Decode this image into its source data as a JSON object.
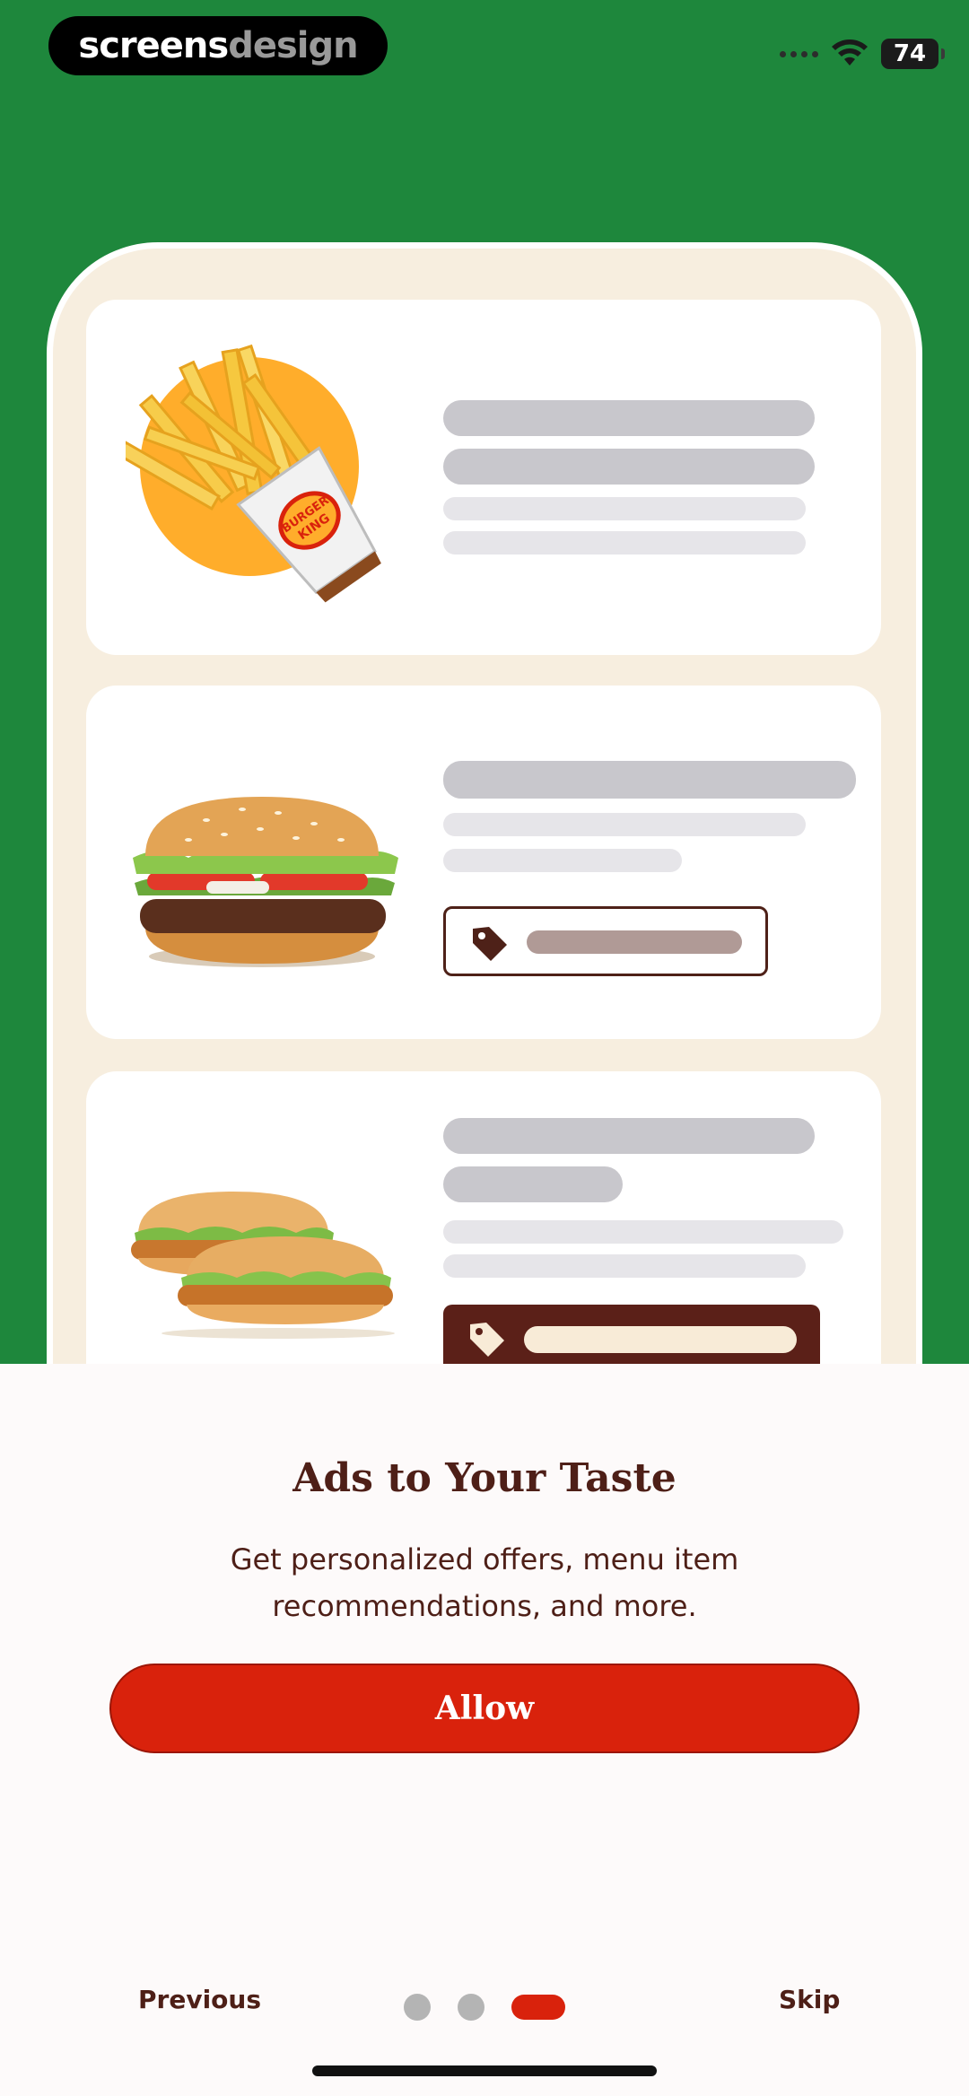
{
  "watermark": {
    "part1": "screens",
    "part2": "design"
  },
  "status_bar": {
    "battery": "74"
  },
  "onboarding": {
    "title": "Ads to Your Taste",
    "description": "Get personalized offers, menu item recommendations, and more.",
    "allow_button": "Allow",
    "previous_label": "Previous",
    "skip_label": "Skip",
    "page_index": 3,
    "page_count": 3
  },
  "illustration": {
    "fries_box_brand": "BURGER KING",
    "foods": [
      "fries",
      "whopper-burger",
      "chicken-sandwiches"
    ],
    "colors": {
      "background": "#1e873c",
      "accent": "#d9220c",
      "brown": "#4e1f17",
      "fries_circle": "#ffad2b"
    }
  }
}
